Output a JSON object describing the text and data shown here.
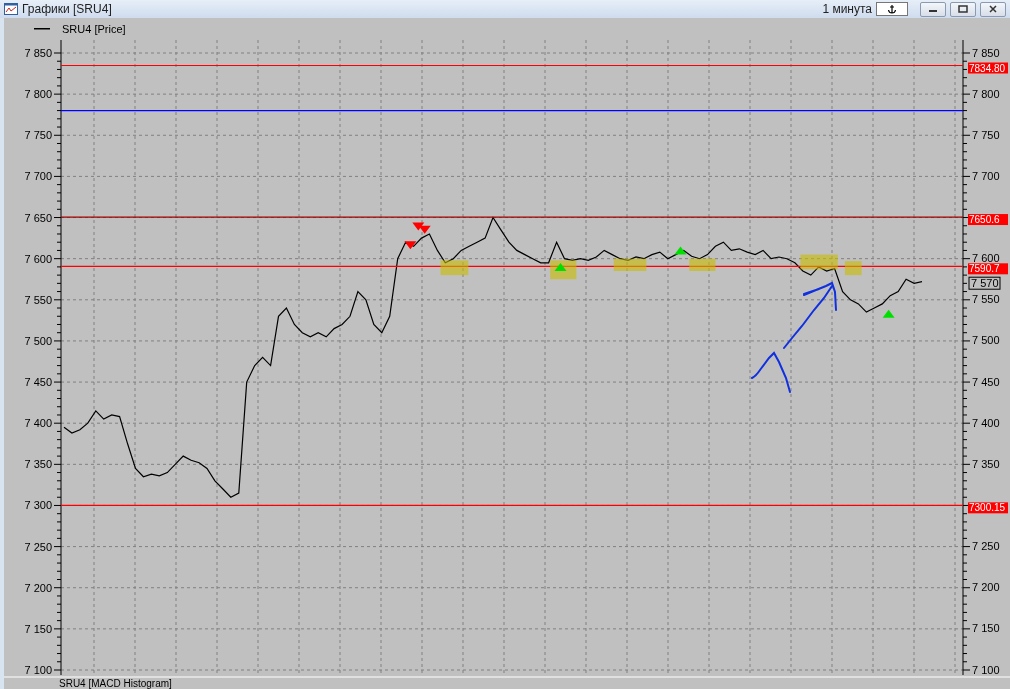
{
  "window": {
    "title": "Графики [SRU4]",
    "interval": "1 минута"
  },
  "price_chart": {
    "chart_data": {
      "type": "line",
      "grid": true,
      "ylim": [
        7100,
        7850
      ],
      "series": [
        {
          "name": "SRU4 [Price]",
          "color": "#000000",
          "values": [
            7395,
            7388,
            7392,
            7400,
            7415,
            7405,
            7410,
            7408,
            7375,
            7345,
            7335,
            7338,
            7336,
            7340,
            7350,
            7360,
            7355,
            7352,
            7345,
            7330,
            7320,
            7310,
            7315,
            7450,
            7470,
            7480,
            7470,
            7530,
            7540,
            7520,
            7510,
            7505,
            7510,
            7505,
            7515,
            7520,
            7530,
            7560,
            7550,
            7520,
            7510,
            7530,
            7600,
            7620,
            7615,
            7625,
            7630,
            7610,
            7595,
            7600,
            7610,
            7615,
            7620,
            7625,
            7650,
            7635,
            7620,
            7610,
            7605,
            7600,
            7595,
            7595,
            7620,
            7600,
            7598,
            7600,
            7598,
            7602,
            7610,
            7605,
            7600,
            7598,
            7602,
            7600,
            7605,
            7608,
            7600,
            7605,
            7610,
            7603,
            7600,
            7605,
            7615,
            7620,
            7610,
            7612,
            7608,
            7605,
            7610,
            7600,
            7602,
            7600,
            7595,
            7585,
            7580,
            7590,
            7585,
            7588,
            7560,
            7550,
            7545,
            7535,
            7540,
            7545,
            7555,
            7560,
            7575,
            7570,
            7572
          ]
        }
      ],
      "yticks": [
        {
          "value": 7100,
          "label": "7 100"
        },
        {
          "value": 7150,
          "label": "7 150"
        },
        {
          "value": 7200,
          "label": "7 200"
        },
        {
          "value": 7250,
          "label": "7 250"
        },
        {
          "value": 7300,
          "label": "7 300"
        },
        {
          "value": 7350,
          "label": "7 350"
        },
        {
          "value": 7400,
          "label": "7 400"
        },
        {
          "value": 7450,
          "label": "7 450"
        },
        {
          "value": 7500,
          "label": "7 500"
        },
        {
          "value": 7550,
          "label": "7 550"
        },
        {
          "value": 7600,
          "label": "7 600"
        },
        {
          "value": 7650,
          "label": "7 650"
        },
        {
          "value": 7700,
          "label": "7 700"
        },
        {
          "value": 7750,
          "label": "7 750"
        },
        {
          "value": 7800,
          "label": "7 800"
        },
        {
          "value": 7850,
          "label": "7 850"
        }
      ],
      "ref_lines": [
        {
          "axis": "y",
          "value": 7834.8,
          "label": "7834.80",
          "color": "#ff0000"
        },
        {
          "axis": "y",
          "value": 7780,
          "color": "#0000ff"
        },
        {
          "axis": "y",
          "value": 7650.6,
          "label": "7650.6",
          "color": "#a00000"
        },
        {
          "axis": "y",
          "value": 7590.7,
          "label": "7590.7",
          "color": "#ff0000"
        },
        {
          "axis": "y",
          "value": 7300.15,
          "label": "7300.15",
          "color": "#ff0000"
        }
      ]
    },
    "current_price": {
      "label": "7 570"
    }
  },
  "lower_panel": {
    "title": "SRU4 [MACD Histogram]"
  }
}
